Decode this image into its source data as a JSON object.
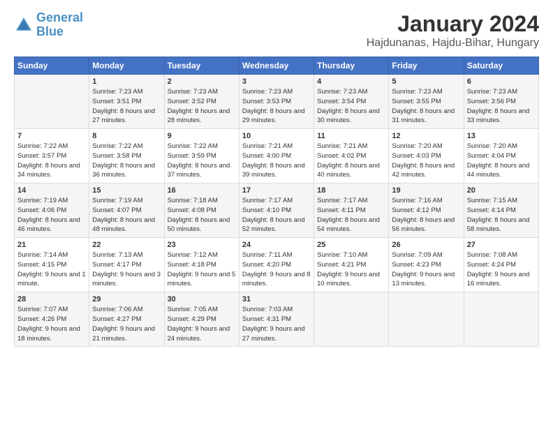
{
  "header": {
    "logo_general": "General",
    "logo_blue": "Blue",
    "title": "January 2024",
    "location": "Hajdunanas, Hajdu-Bihar, Hungary"
  },
  "weekdays": [
    "Sunday",
    "Monday",
    "Tuesday",
    "Wednesday",
    "Thursday",
    "Friday",
    "Saturday"
  ],
  "weeks": [
    [
      {
        "day": "",
        "sunrise": "",
        "sunset": "",
        "daylight": ""
      },
      {
        "day": "1",
        "sunrise": "Sunrise: 7:23 AM",
        "sunset": "Sunset: 3:51 PM",
        "daylight": "Daylight: 8 hours and 27 minutes."
      },
      {
        "day": "2",
        "sunrise": "Sunrise: 7:23 AM",
        "sunset": "Sunset: 3:52 PM",
        "daylight": "Daylight: 8 hours and 28 minutes."
      },
      {
        "day": "3",
        "sunrise": "Sunrise: 7:23 AM",
        "sunset": "Sunset: 3:53 PM",
        "daylight": "Daylight: 8 hours and 29 minutes."
      },
      {
        "day": "4",
        "sunrise": "Sunrise: 7:23 AM",
        "sunset": "Sunset: 3:54 PM",
        "daylight": "Daylight: 8 hours and 30 minutes."
      },
      {
        "day": "5",
        "sunrise": "Sunrise: 7:23 AM",
        "sunset": "Sunset: 3:55 PM",
        "daylight": "Daylight: 8 hours and 31 minutes."
      },
      {
        "day": "6",
        "sunrise": "Sunrise: 7:23 AM",
        "sunset": "Sunset: 3:56 PM",
        "daylight": "Daylight: 8 hours and 33 minutes."
      }
    ],
    [
      {
        "day": "7",
        "sunrise": "Sunrise: 7:22 AM",
        "sunset": "Sunset: 3:57 PM",
        "daylight": "Daylight: 8 hours and 34 minutes."
      },
      {
        "day": "8",
        "sunrise": "Sunrise: 7:22 AM",
        "sunset": "Sunset: 3:58 PM",
        "daylight": "Daylight: 8 hours and 36 minutes."
      },
      {
        "day": "9",
        "sunrise": "Sunrise: 7:22 AM",
        "sunset": "Sunset: 3:59 PM",
        "daylight": "Daylight: 8 hours and 37 minutes."
      },
      {
        "day": "10",
        "sunrise": "Sunrise: 7:21 AM",
        "sunset": "Sunset: 4:00 PM",
        "daylight": "Daylight: 8 hours and 39 minutes."
      },
      {
        "day": "11",
        "sunrise": "Sunrise: 7:21 AM",
        "sunset": "Sunset: 4:02 PM",
        "daylight": "Daylight: 8 hours and 40 minutes."
      },
      {
        "day": "12",
        "sunrise": "Sunrise: 7:20 AM",
        "sunset": "Sunset: 4:03 PM",
        "daylight": "Daylight: 8 hours and 42 minutes."
      },
      {
        "day": "13",
        "sunrise": "Sunrise: 7:20 AM",
        "sunset": "Sunset: 4:04 PM",
        "daylight": "Daylight: 8 hours and 44 minutes."
      }
    ],
    [
      {
        "day": "14",
        "sunrise": "Sunrise: 7:19 AM",
        "sunset": "Sunset: 4:06 PM",
        "daylight": "Daylight: 8 hours and 46 minutes."
      },
      {
        "day": "15",
        "sunrise": "Sunrise: 7:19 AM",
        "sunset": "Sunset: 4:07 PM",
        "daylight": "Daylight: 8 hours and 48 minutes."
      },
      {
        "day": "16",
        "sunrise": "Sunrise: 7:18 AM",
        "sunset": "Sunset: 4:08 PM",
        "daylight": "Daylight: 8 hours and 50 minutes."
      },
      {
        "day": "17",
        "sunrise": "Sunrise: 7:17 AM",
        "sunset": "Sunset: 4:10 PM",
        "daylight": "Daylight: 8 hours and 52 minutes."
      },
      {
        "day": "18",
        "sunrise": "Sunrise: 7:17 AM",
        "sunset": "Sunset: 4:11 PM",
        "daylight": "Daylight: 8 hours and 54 minutes."
      },
      {
        "day": "19",
        "sunrise": "Sunrise: 7:16 AM",
        "sunset": "Sunset: 4:12 PM",
        "daylight": "Daylight: 8 hours and 56 minutes."
      },
      {
        "day": "20",
        "sunrise": "Sunrise: 7:15 AM",
        "sunset": "Sunset: 4:14 PM",
        "daylight": "Daylight: 8 hours and 58 minutes."
      }
    ],
    [
      {
        "day": "21",
        "sunrise": "Sunrise: 7:14 AM",
        "sunset": "Sunset: 4:15 PM",
        "daylight": "Daylight: 9 hours and 1 minute."
      },
      {
        "day": "22",
        "sunrise": "Sunrise: 7:13 AM",
        "sunset": "Sunset: 4:17 PM",
        "daylight": "Daylight: 9 hours and 3 minutes."
      },
      {
        "day": "23",
        "sunrise": "Sunrise: 7:12 AM",
        "sunset": "Sunset: 4:18 PM",
        "daylight": "Daylight: 9 hours and 5 minutes."
      },
      {
        "day": "24",
        "sunrise": "Sunrise: 7:11 AM",
        "sunset": "Sunset: 4:20 PM",
        "daylight": "Daylight: 9 hours and 8 minutes."
      },
      {
        "day": "25",
        "sunrise": "Sunrise: 7:10 AM",
        "sunset": "Sunset: 4:21 PM",
        "daylight": "Daylight: 9 hours and 10 minutes."
      },
      {
        "day": "26",
        "sunrise": "Sunrise: 7:09 AM",
        "sunset": "Sunset: 4:23 PM",
        "daylight": "Daylight: 9 hours and 13 minutes."
      },
      {
        "day": "27",
        "sunrise": "Sunrise: 7:08 AM",
        "sunset": "Sunset: 4:24 PM",
        "daylight": "Daylight: 9 hours and 16 minutes."
      }
    ],
    [
      {
        "day": "28",
        "sunrise": "Sunrise: 7:07 AM",
        "sunset": "Sunset: 4:26 PM",
        "daylight": "Daylight: 9 hours and 18 minutes."
      },
      {
        "day": "29",
        "sunrise": "Sunrise: 7:06 AM",
        "sunset": "Sunset: 4:27 PM",
        "daylight": "Daylight: 9 hours and 21 minutes."
      },
      {
        "day": "30",
        "sunrise": "Sunrise: 7:05 AM",
        "sunset": "Sunset: 4:29 PM",
        "daylight": "Daylight: 9 hours and 24 minutes."
      },
      {
        "day": "31",
        "sunrise": "Sunrise: 7:03 AM",
        "sunset": "Sunset: 4:31 PM",
        "daylight": "Daylight: 9 hours and 27 minutes."
      },
      {
        "day": "",
        "sunrise": "",
        "sunset": "",
        "daylight": ""
      },
      {
        "day": "",
        "sunrise": "",
        "sunset": "",
        "daylight": ""
      },
      {
        "day": "",
        "sunrise": "",
        "sunset": "",
        "daylight": ""
      }
    ]
  ]
}
